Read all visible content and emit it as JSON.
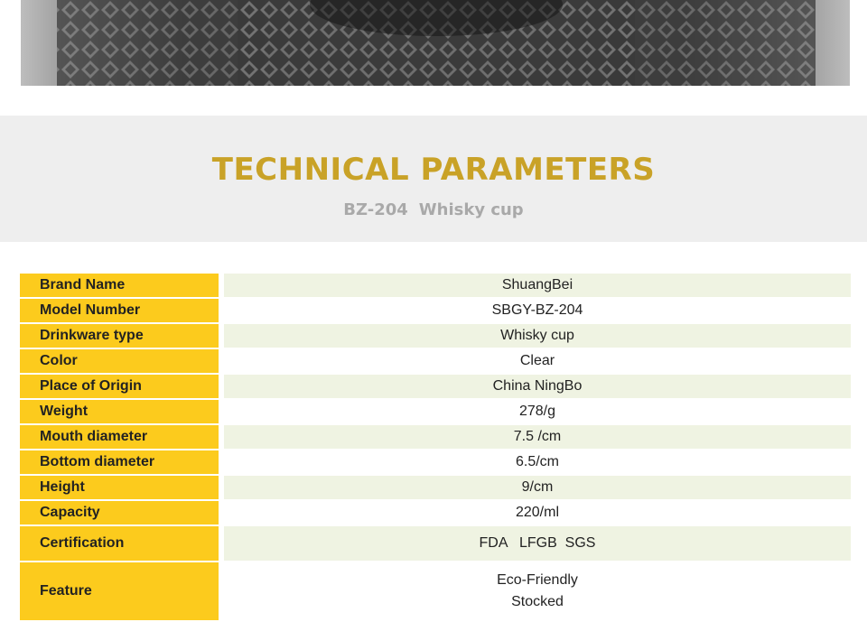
{
  "hero": {
    "image_name": "crystal-whisky-glasses-photo"
  },
  "section": {
    "title": "TECHNICAL PARAMETERS",
    "model": "BZ-204",
    "product": "Whisky cup"
  },
  "specs": [
    {
      "label": "Brand Name",
      "values": [
        "ShuangBei"
      ]
    },
    {
      "label": "Model Number",
      "values": [
        "SBGY-BZ-204"
      ]
    },
    {
      "label": "Drinkware type",
      "values": [
        "Whisky cup"
      ]
    },
    {
      "label": "Color",
      "values": [
        "Clear"
      ]
    },
    {
      "label": "Place of Origin",
      "values": [
        "China NingBo"
      ]
    },
    {
      "label": "Weight",
      "values": [
        "278/g"
      ]
    },
    {
      "label": "Mouth diameter",
      "values": [
        "7.5 /cm"
      ]
    },
    {
      "label": "Bottom diameter",
      "values": [
        "6.5/cm"
      ]
    },
    {
      "label": "Height",
      "values": [
        "9/cm"
      ]
    },
    {
      "label": "Capacity",
      "values": [
        "220/ml"
      ]
    },
    {
      "label": "Certification",
      "values": [
        "FDA   LFGB  SGS"
      ]
    },
    {
      "label": "Feature",
      "values": [
        "Eco-Friendly",
        "Stocked"
      ]
    }
  ],
  "colors": {
    "accent": "#c9a227",
    "label_bg": "#fccb1d",
    "alt_row": "#eff3e2",
    "band": "#eeeeee"
  }
}
